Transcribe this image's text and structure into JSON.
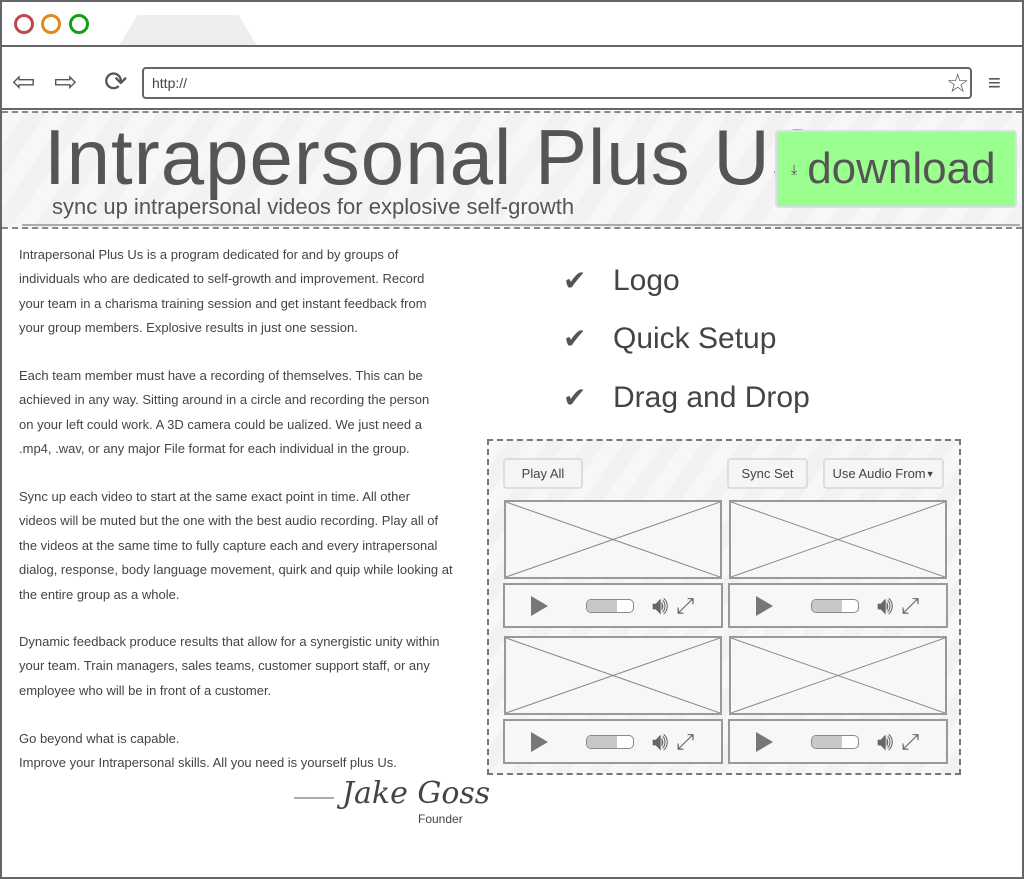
{
  "browser": {
    "url": "http://",
    "controls": {
      "close_color": "#c0484a",
      "minimize_color": "#e08a1e",
      "maximize_color": "#17a017"
    }
  },
  "header": {
    "title": "Intrapersonal Plus US",
    "subtitle": "sync up intrapersonal videos for explosive self-growth",
    "download_label": "download",
    "download_color": "#9aff8f"
  },
  "body": {
    "paragraphs": [
      [
        "Intrapersonal Plus Us is a program dedicated for and by groups of",
        "individuals who are dedicated to self-growth and improvement. Record",
        "your team in a charisma training session and get instant feedback from",
        "your group members. Explosive results in just one session."
      ],
      [
        "Each team member must have a recording of themselves. This can be",
        "achieved in any way. Sitting around in a circle and recording the person",
        "on your left could work. A 3D camera could be ualized. We just need a",
        ".mp4, .wav, or any major File format for each individual in the group."
      ],
      [
        "Sync up each video to start at the same exact point in time. All other",
        "videos will be muted but the one with the best audio recording. Play all of",
        "the videos at the same time to fully capture each and every intrapersonal",
        "dialog, response, body language movement, quirk and quip while looking at",
        "the entire group as a whole."
      ],
      [
        "Dynamic feedback produce results that allow for a synergistic unity within",
        "your team. Train managers, sales teams, customer support staff, or any",
        "employee who will be in front of a customer."
      ],
      [
        "Go beyond what is capable.",
        "Improve your Intrapersonal skills. All you need is yourself plus Us."
      ]
    ],
    "signature": "Jake Goss",
    "signature_role": "Founder"
  },
  "features": [
    "Logo",
    "Quick Setup",
    "Drag and Drop"
  ],
  "player": {
    "play_all": "Play All",
    "sync_set": "Sync Set",
    "audio_select": "Use Audio From",
    "videos": [
      {
        "progress": 0.65
      },
      {
        "progress": 0.65
      },
      {
        "progress": 0.65
      },
      {
        "progress": 0.65
      }
    ]
  }
}
